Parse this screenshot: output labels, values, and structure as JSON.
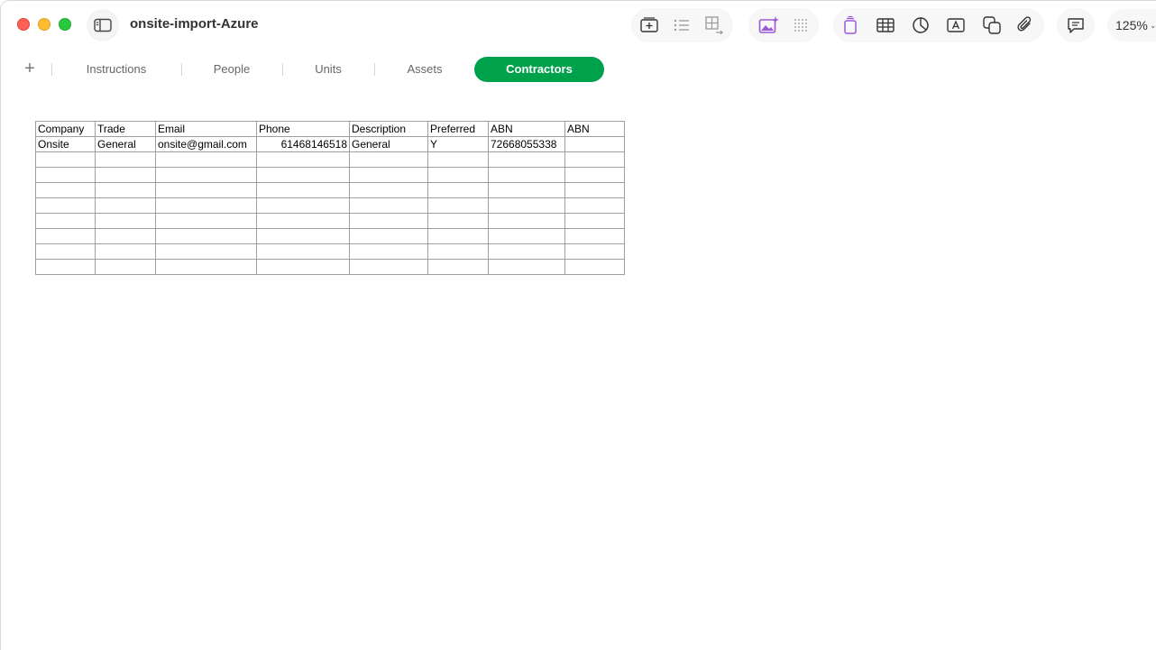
{
  "window": {
    "title": "onsite-import-Azure"
  },
  "toolbar": {
    "zoom": "125%",
    "icons": [
      "insert-sheet-icon",
      "list-icon",
      "table-adjust-icon",
      "media-icon",
      "grid-dots-icon",
      "organize-icon",
      "table-icon",
      "chart-icon",
      "text-icon",
      "shape-icon",
      "attachment-icon",
      "comment-icon"
    ],
    "accent": "#9b59d6"
  },
  "tabs": [
    {
      "label": "Instructions",
      "active": false
    },
    {
      "label": "People",
      "active": false
    },
    {
      "label": "Units",
      "active": false
    },
    {
      "label": "Assets",
      "active": false
    },
    {
      "label": "Contractors",
      "active": true
    }
  ],
  "tab_active_color": "#00a14b",
  "table": {
    "headers": [
      "Company",
      "Trade",
      "Email",
      "Phone",
      "Description",
      "Preferred",
      "ABN",
      "ABN"
    ],
    "rows": [
      [
        "Onsite",
        "General",
        "onsite@gmail.com",
        "61468146518",
        "General",
        "Y",
        "72668055338",
        ""
      ],
      [
        "",
        "",
        "",
        "",
        "",
        "",
        "",
        ""
      ],
      [
        "",
        "",
        "",
        "",
        "",
        "",
        "",
        ""
      ],
      [
        "",
        "",
        "",
        "",
        "",
        "",
        "",
        ""
      ],
      [
        "",
        "",
        "",
        "",
        "",
        "",
        "",
        ""
      ],
      [
        "",
        "",
        "",
        "",
        "",
        "",
        "",
        ""
      ],
      [
        "",
        "",
        "",
        "",
        "",
        "",
        "",
        ""
      ],
      [
        "",
        "",
        "",
        "",
        "",
        "",
        "",
        ""
      ],
      [
        "",
        "",
        "",
        "",
        "",
        "",
        "",
        ""
      ]
    ]
  }
}
